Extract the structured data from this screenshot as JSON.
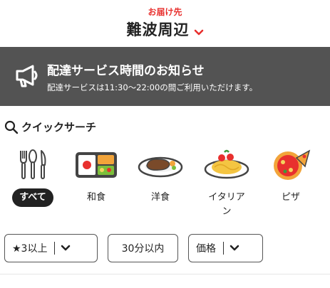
{
  "header": {
    "deliver_label": "お届け先",
    "location": "難波周辺",
    "chevron_icon": "chevron-down-icon",
    "accent_color": "#e8302e"
  },
  "banner": {
    "icon": "megaphone-icon",
    "title": "配達サービス時間のお知らせ",
    "subtitle": "配達サービスは11:30〜22:00の間ご利用いただけます。",
    "background": "#535353"
  },
  "quick_search": {
    "icon": "search-icon",
    "title": "クイックサーチ",
    "categories": [
      {
        "label": "すべて",
        "icon": "cutlery-icon",
        "selected": true
      },
      {
        "label": "和食",
        "icon": "bento-icon",
        "selected": false
      },
      {
        "label": "洋食",
        "icon": "steak-icon",
        "selected": false
      },
      {
        "label": "イタリアン",
        "icon": "pasta-icon",
        "selected": false
      },
      {
        "label": "ピザ",
        "icon": "pizza-icon",
        "selected": false
      }
    ]
  },
  "filters": {
    "rating": "★3以上",
    "time": "30分以内",
    "price": "価格"
  }
}
